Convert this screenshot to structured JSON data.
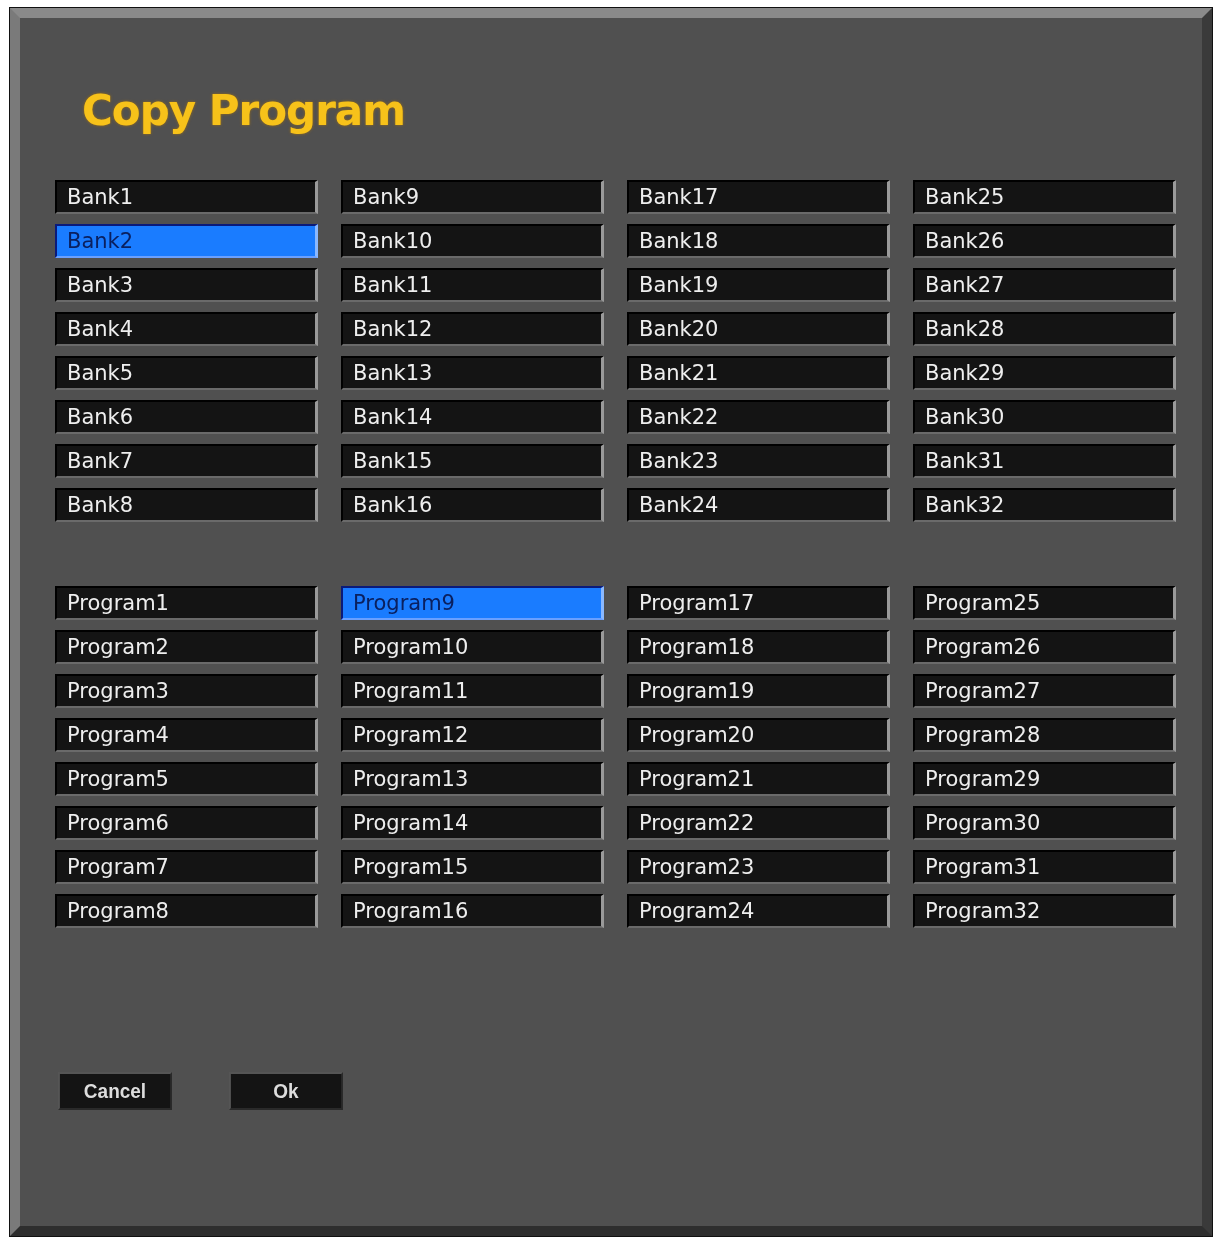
{
  "window": {
    "title": "Copy Program"
  },
  "banks": [
    {
      "label": "Bank1",
      "selected": false
    },
    {
      "label": "Bank2",
      "selected": true
    },
    {
      "label": "Bank3",
      "selected": false
    },
    {
      "label": "Bank4",
      "selected": false
    },
    {
      "label": "Bank5",
      "selected": false
    },
    {
      "label": "Bank6",
      "selected": false
    },
    {
      "label": "Bank7",
      "selected": false
    },
    {
      "label": "Bank8",
      "selected": false
    },
    {
      "label": "Bank9",
      "selected": false
    },
    {
      "label": "Bank10",
      "selected": false
    },
    {
      "label": "Bank11",
      "selected": false
    },
    {
      "label": "Bank12",
      "selected": false
    },
    {
      "label": "Bank13",
      "selected": false
    },
    {
      "label": "Bank14",
      "selected": false
    },
    {
      "label": "Bank15",
      "selected": false
    },
    {
      "label": "Bank16",
      "selected": false
    },
    {
      "label": "Bank17",
      "selected": false
    },
    {
      "label": "Bank18",
      "selected": false
    },
    {
      "label": "Bank19",
      "selected": false
    },
    {
      "label": "Bank20",
      "selected": false
    },
    {
      "label": "Bank21",
      "selected": false
    },
    {
      "label": "Bank22",
      "selected": false
    },
    {
      "label": "Bank23",
      "selected": false
    },
    {
      "label": "Bank24",
      "selected": false
    },
    {
      "label": "Bank25",
      "selected": false
    },
    {
      "label": "Bank26",
      "selected": false
    },
    {
      "label": "Bank27",
      "selected": false
    },
    {
      "label": "Bank28",
      "selected": false
    },
    {
      "label": "Bank29",
      "selected": false
    },
    {
      "label": "Bank30",
      "selected": false
    },
    {
      "label": "Bank31",
      "selected": false
    },
    {
      "label": "Bank32",
      "selected": false
    }
  ],
  "programs": [
    {
      "label": "Program1",
      "selected": false
    },
    {
      "label": "Program2",
      "selected": false
    },
    {
      "label": "Program3",
      "selected": false
    },
    {
      "label": "Program4",
      "selected": false
    },
    {
      "label": "Program5",
      "selected": false
    },
    {
      "label": "Program6",
      "selected": false
    },
    {
      "label": "Program7",
      "selected": false
    },
    {
      "label": "Program8",
      "selected": false
    },
    {
      "label": "Program9",
      "selected": true
    },
    {
      "label": "Program10",
      "selected": false
    },
    {
      "label": "Program11",
      "selected": false
    },
    {
      "label": "Program12",
      "selected": false
    },
    {
      "label": "Program13",
      "selected": false
    },
    {
      "label": "Program14",
      "selected": false
    },
    {
      "label": "Program15",
      "selected": false
    },
    {
      "label": "Program16",
      "selected": false
    },
    {
      "label": "Program17",
      "selected": false
    },
    {
      "label": "Program18",
      "selected": false
    },
    {
      "label": "Program19",
      "selected": false
    },
    {
      "label": "Program20",
      "selected": false
    },
    {
      "label": "Program21",
      "selected": false
    },
    {
      "label": "Program22",
      "selected": false
    },
    {
      "label": "Program23",
      "selected": false
    },
    {
      "label": "Program24",
      "selected": false
    },
    {
      "label": "Program25",
      "selected": false
    },
    {
      "label": "Program26",
      "selected": false
    },
    {
      "label": "Program27",
      "selected": false
    },
    {
      "label": "Program28",
      "selected": false
    },
    {
      "label": "Program29",
      "selected": false
    },
    {
      "label": "Program30",
      "selected": false
    },
    {
      "label": "Program31",
      "selected": false
    },
    {
      "label": "Program32",
      "selected": false
    }
  ],
  "buttons": [
    {
      "label": "Cancel"
    },
    {
      "label": "Ok"
    }
  ]
}
